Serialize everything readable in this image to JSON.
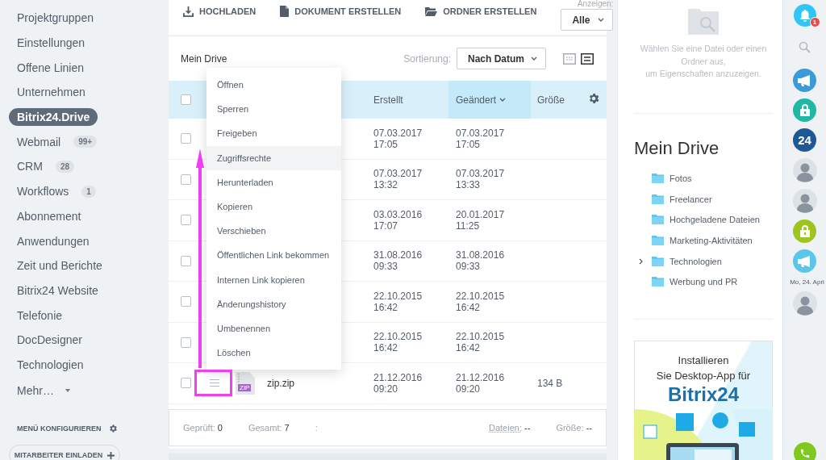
{
  "sidebar": {
    "items": [
      {
        "label": "Projektgruppen",
        "selected": false
      },
      {
        "label": "Einstellungen",
        "selected": false
      },
      {
        "label": "Offene Linien",
        "selected": false
      },
      {
        "label": "Unternehmen",
        "selected": false
      },
      {
        "label": "Bitrix24.Drive",
        "selected": true
      },
      {
        "label": "Webmail",
        "badge": "99+",
        "selected": false
      },
      {
        "label": "CRM",
        "badge": "28",
        "selected": false
      },
      {
        "label": "Workflows",
        "badge": "1",
        "selected": false
      },
      {
        "label": "Abonnement",
        "selected": false
      },
      {
        "label": "Anwendungen",
        "selected": false
      },
      {
        "label": "Zeit und Berichte",
        "selected": false
      },
      {
        "label": "Bitrix24 Website",
        "selected": false
      },
      {
        "label": "Telefonie",
        "selected": false
      },
      {
        "label": "DocDesigner",
        "selected": false
      },
      {
        "label": "Technologien",
        "selected": false
      }
    ],
    "more": "Mehr…",
    "configure": "MENÜ KONFIGURIEREN",
    "invite": "MITARBEITER EINLADEN"
  },
  "toolbar": {
    "actions": [
      {
        "label": "HOCHLADEN",
        "kind": "upload"
      },
      {
        "label": "DOKUMENT ERSTELLEN",
        "kind": "document"
      },
      {
        "label": "ORDNER ERSTELLEN",
        "kind": "folder"
      }
    ],
    "filter": {
      "label": "Anzeigen:",
      "value": "Alle"
    }
  },
  "breadcrumb": "Mein Drive",
  "sort": {
    "label": "Sortierung:",
    "value": "Nach Datum"
  },
  "view_modes": [
    {
      "kind": "grid",
      "selected": false
    },
    {
      "kind": "list",
      "selected": true
    }
  ],
  "table": {
    "all_checked": false,
    "columns": [
      {
        "label": "Erstellt",
        "sorted": false
      },
      {
        "label": "Geändert",
        "sorted": true
      },
      {
        "label": "Größe",
        "sorted": false
      }
    ],
    "rows": [
      {
        "checked": false,
        "created": [
          "07.03.2017",
          "17:05"
        ],
        "modified": [
          "07.03.2017",
          "17:05"
        ]
      },
      {
        "checked": false,
        "created": [
          "07.03.2017",
          "13:32"
        ],
        "modified": [
          "07.03.2017",
          "13:33"
        ]
      },
      {
        "checked": false,
        "created": [
          "03.03.2016",
          "17:07"
        ],
        "modified": [
          "20.01.2017",
          "11:25"
        ]
      },
      {
        "checked": false,
        "created": [
          "31.08.2016",
          "09:33"
        ],
        "modified": [
          "31.08.2016",
          "09:33"
        ]
      },
      {
        "checked": false,
        "created": [
          "22.10.2015",
          "16:42"
        ],
        "modified": [
          "22.10.2015",
          "16:42"
        ]
      },
      {
        "checked": false,
        "created": [
          "22.10.2015",
          "16:42"
        ],
        "modified": [
          "22.10.2015",
          "16:42"
        ]
      },
      {
        "checked": false,
        "name": "zip.zip",
        "file_label": "ZIP",
        "size": "134 B",
        "created": [
          "21.12.2016",
          "09:20"
        ],
        "modified": [
          "21.12.2016",
          "09:20"
        ]
      }
    ]
  },
  "context_menu": {
    "items": [
      {
        "label": "Öffnen",
        "selected": false
      },
      {
        "label": "Sperren",
        "selected": false
      },
      {
        "label": "Freigeben",
        "selected": false
      },
      {
        "label": "Zugriffsrechte",
        "selected": true
      },
      {
        "label": "Herunterladen",
        "selected": false
      },
      {
        "label": "Kopieren",
        "selected": false
      },
      {
        "label": "Verschieben",
        "selected": false
      },
      {
        "label": "Öffentlichen Link bekommen",
        "selected": false
      },
      {
        "label": "Internen Link kopieren",
        "selected": false
      },
      {
        "label": "Änderungshistory",
        "selected": false
      },
      {
        "label": "Umbenennen",
        "selected": false
      },
      {
        "label": "Löschen",
        "selected": false
      }
    ]
  },
  "footer": {
    "checked": {
      "label": "Geprüft:",
      "value": "0"
    },
    "total": {
      "label": "Gesamt:",
      "value": "7"
    },
    "separator": ":",
    "files": {
      "label": "Dateien:",
      "value": "--"
    },
    "size": {
      "label": "Größe:",
      "value": "--"
    }
  },
  "details": {
    "hint": [
      "Wählen Sie eine Datei oder einen Ordner aus,",
      "um Eigenschaften anzuzeigen."
    ],
    "title": "Mein Drive",
    "folders": [
      {
        "label": "Fotos",
        "expandable": false
      },
      {
        "label": "Freelancer",
        "expandable": false
      },
      {
        "label": "Hochgeladene Dateien",
        "expandable": false
      },
      {
        "label": "Marketing-Aktivitäten",
        "expandable": false
      },
      {
        "label": "Technologien",
        "expandable": true
      },
      {
        "label": "Werbung und PR",
        "expandable": false
      }
    ],
    "ad": {
      "lines": [
        "Installieren",
        "Sie Desktop-App für"
      ],
      "brand": "Bitrix24"
    }
  },
  "rightbar": {
    "items": [
      {
        "kind": "bell",
        "badge": "1",
        "color": "#2fc6f6"
      },
      {
        "kind": "search"
      },
      {
        "kind": "megaphone",
        "color": "#3a9bd8"
      },
      {
        "kind": "lock",
        "color": "#1fb8a4"
      },
      {
        "kind": "logo",
        "text": "24",
        "color": "#1f5995"
      },
      {
        "kind": "avatar"
      },
      {
        "kind": "avatar"
      },
      {
        "kind": "lock",
        "color": "#9dc41f"
      },
      {
        "kind": "megaphone",
        "color": "#5cc6ea"
      },
      {
        "kind": "date",
        "text": "Mo, 24. Apri"
      },
      {
        "kind": "avatar"
      }
    ]
  }
}
